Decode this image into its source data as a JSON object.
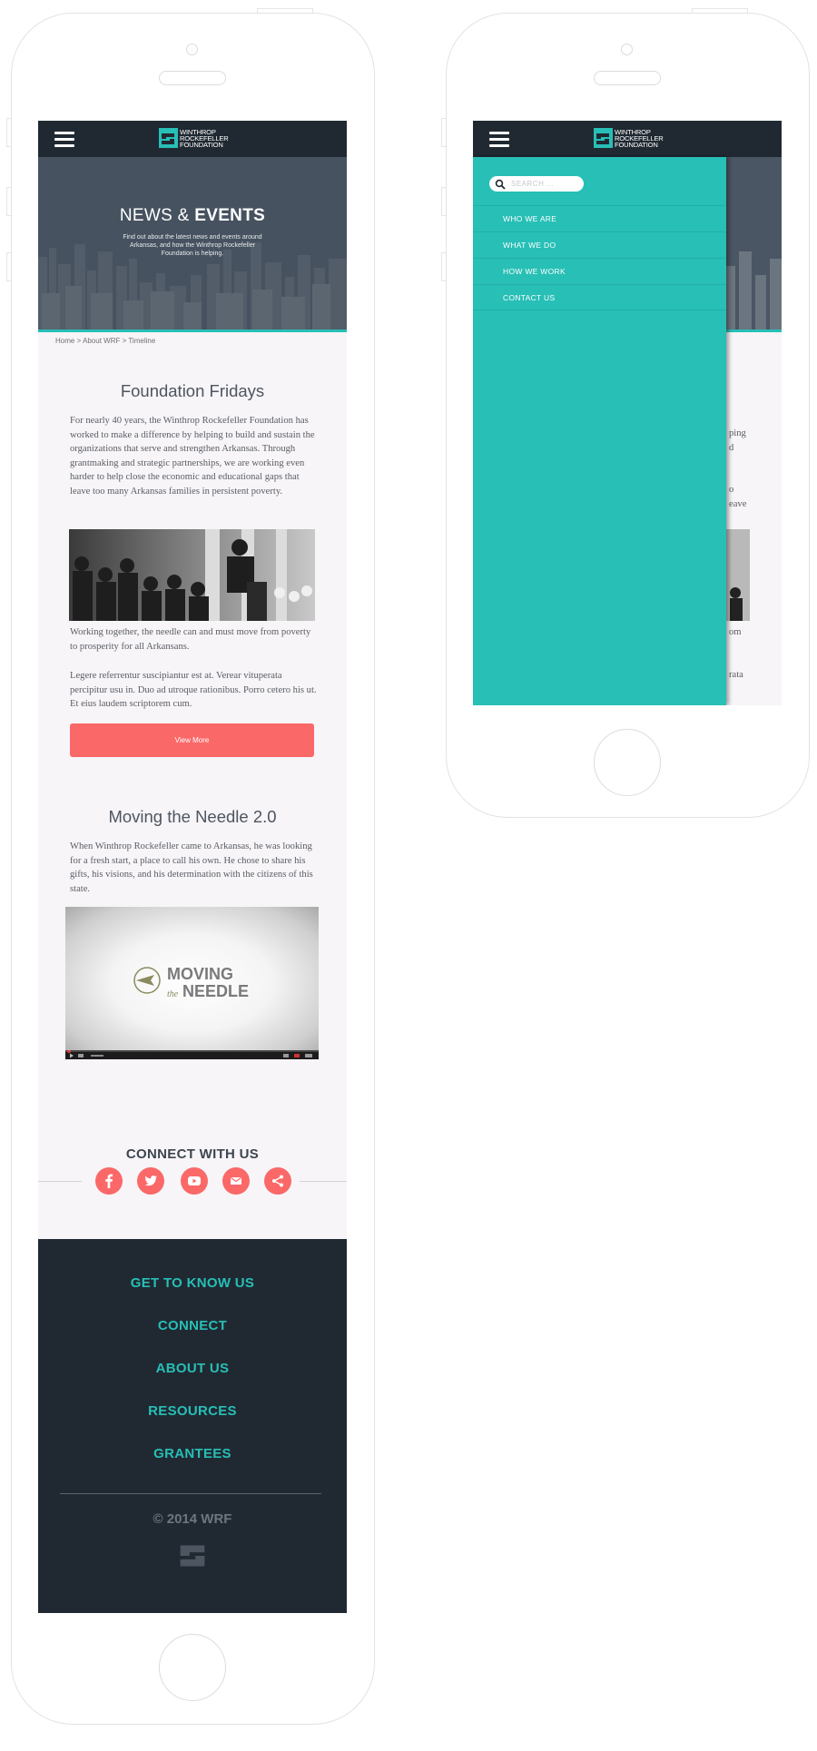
{
  "brand": {
    "logo_lines": [
      "Winthrop",
      "Rockefeller",
      "Foundation"
    ],
    "colors": {
      "teal": "#27bfb6",
      "navy": "#202932",
      "coral": "#fb6868"
    }
  },
  "nav": {
    "menu_icon": "hamburger-icon"
  },
  "hero": {
    "title_light": "NEWS &",
    "title_bold": "EVENTS",
    "subtitle": "Find out about the latest news and events around Arkansas, and how the Winthrop Rockefeller Foundation is helping."
  },
  "breadcrumb": "Home > About WRF > Timeline",
  "section1": {
    "title": "Foundation Fridays",
    "para1": "For nearly 40 years, the Winthrop Rockefeller Foundation has worked to make a difference by helping to build and sustain the organizations that serve and strengthen Arkansas. Through grantmaking and strategic partnerships, we are working even harder to help close the economic and educational gaps that leave too many Arkansas families in persistent poverty.",
    "para2": "Working together, the needle can and must move from poverty to prosperity for all Arkansans.",
    "para3": "Legere referrentur suscipiantur est at. Verear vituperata percipitur usu in. Duo ad utroque rationibus. Porro cetero his ut. Et eius laudem scriptorem cum.",
    "button": "View More"
  },
  "section2": {
    "title": "Moving the Needle 2.0",
    "para": "When Winthrop Rockefeller came to Arkansas, he was looking for a fresh start, a place to call his own. He chose to share his gifts, his visions, and his determination with the citizens of this state.",
    "video_logo": {
      "line1": "MOVING",
      "the": "the",
      "line2": "NEEDLE"
    }
  },
  "connect": {
    "title": "CONNECT WITH US",
    "icons": [
      "facebook-icon",
      "twitter-icon",
      "youtube-icon",
      "email-icon",
      "share-icon"
    ]
  },
  "footer": {
    "links": [
      "GET TO KNOW US",
      "CONNECT",
      "ABOUT US",
      "RESOURCES",
      "GRANTEES"
    ],
    "copyright": "© 2014 WRF"
  },
  "drawer": {
    "search_placeholder": "SEARCH ...",
    "items": [
      "WHO WE ARE",
      "WHAT WE DO",
      "HOW WE WORK",
      "CONTACT US"
    ]
  },
  "right_peek_text": {
    "s1_lines": [
      "ping",
      "d",
      "",
      "",
      "o",
      "eave"
    ],
    "s2_lines": [
      "om",
      "",
      "",
      "rata"
    ]
  }
}
